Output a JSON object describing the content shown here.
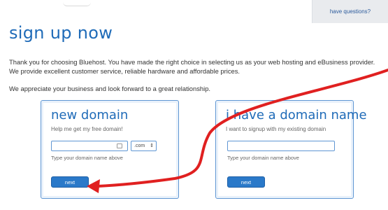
{
  "header": {
    "help_link": "have questions?"
  },
  "page": {
    "title": "sign up now",
    "intro_line1": "Thank you for choosing Bluehost. You have made the right choice in selecting us as your web hosting and eBusiness provider.",
    "intro_line2": "We provide excellent customer service, reliable hardware and affordable prices.",
    "intro_line3": "We appreciate your business and look forward to a great relationship."
  },
  "new_domain": {
    "title": "new domain",
    "subtitle": "Help me get my free domain!",
    "input_value": "",
    "tld_selected": ".com",
    "helper": "Type your domain name above",
    "button": "next"
  },
  "existing_domain": {
    "title": "i have a domain name",
    "subtitle": "I want to signup with my existing domain",
    "input_value": "",
    "helper": "Type your domain name above",
    "button": "next"
  },
  "annotation": {
    "arrow_color": "#e02020"
  },
  "colors": {
    "brand_blue": "#1f6bb8",
    "button_blue": "#2a79c9",
    "border_blue": "#5f96d3"
  }
}
